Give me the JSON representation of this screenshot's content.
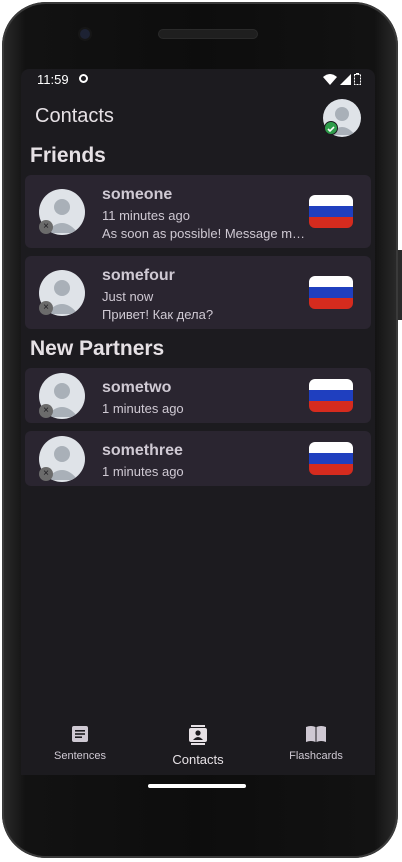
{
  "status": {
    "time": "11:59"
  },
  "appbar": {
    "title": "Contacts"
  },
  "sections": {
    "friends": "Friends",
    "partners": "New Partners"
  },
  "friends": [
    {
      "name": "someone",
      "time": "11 minutes ago",
      "message": "As soon as possible! Message me when you're free"
    },
    {
      "name": "somefour",
      "time": "Just now",
      "message": "Привет! Как дела?"
    }
  ],
  "partners": [
    {
      "name": "sometwo",
      "time": "1 minutes ago"
    },
    {
      "name": "somethree",
      "time": "1 minutes ago"
    }
  ],
  "nav": {
    "sentences": "Sentences",
    "contacts": "Contacts",
    "flashcards": "Flashcards"
  },
  "colors": {
    "card": "#2a2530",
    "background": "#1c1b1f",
    "online": "#2e9d4a",
    "flag_white": "#ffffff",
    "flag_blue": "#1f3fbf",
    "flag_red": "#d52b1e"
  }
}
